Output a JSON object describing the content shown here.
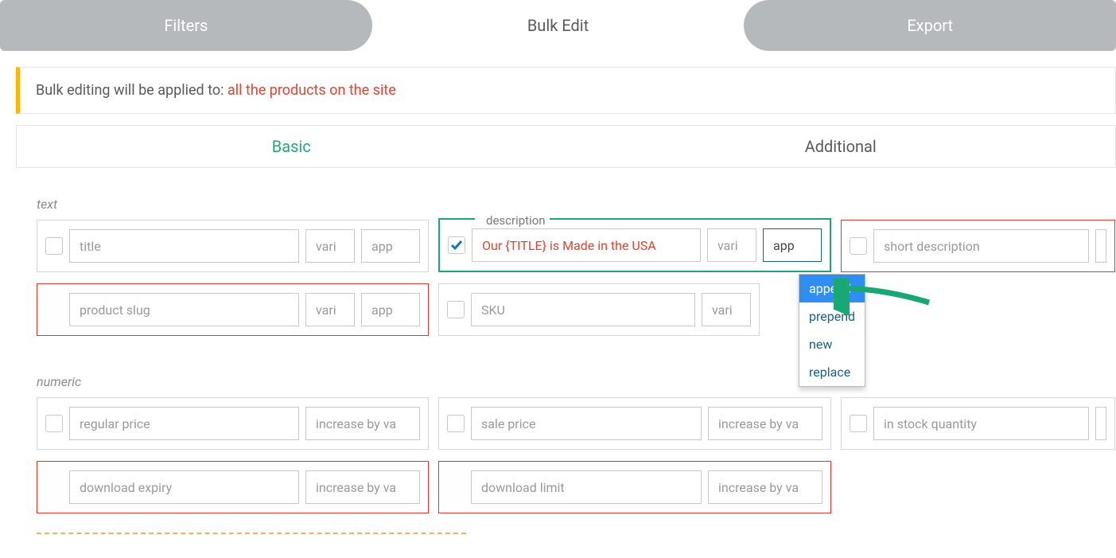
{
  "tabs": {
    "filters": "Filters",
    "bulk_edit": "Bulk Edit",
    "export": "Export"
  },
  "notice": {
    "prefix": "Bulk editing will be applied to: ",
    "target": "all the products on the site"
  },
  "subtabs": {
    "basic": "Basic",
    "additional": "Additional"
  },
  "sections": {
    "text": "text",
    "numeric": "numeric"
  },
  "text_row1": {
    "title": {
      "label": "title",
      "vari": "vari",
      "app": "app"
    },
    "desc": {
      "legend": "description",
      "value": "Our {TITLE} is Made in the USA",
      "vari": "vari",
      "app": "app"
    },
    "short": {
      "label": "short description"
    }
  },
  "text_row2": {
    "slug": {
      "label": "product slug",
      "vari": "vari",
      "app": "app"
    },
    "sku": {
      "label": "SKU",
      "vari": "vari"
    }
  },
  "numeric_row1": {
    "regular": {
      "label": "regular price",
      "op": "increase by va"
    },
    "sale": {
      "label": "sale price",
      "op": "increase by va"
    },
    "stock": {
      "label": "in stock quantity"
    }
  },
  "numeric_row2": {
    "dlexpiry": {
      "label": "download expiry",
      "op": "increase by va"
    },
    "dllimit": {
      "label": "download limit",
      "op": "increase by va"
    }
  },
  "dropdown": {
    "append": "append",
    "prepend": "prepend",
    "new": "new",
    "replace": "replace"
  }
}
